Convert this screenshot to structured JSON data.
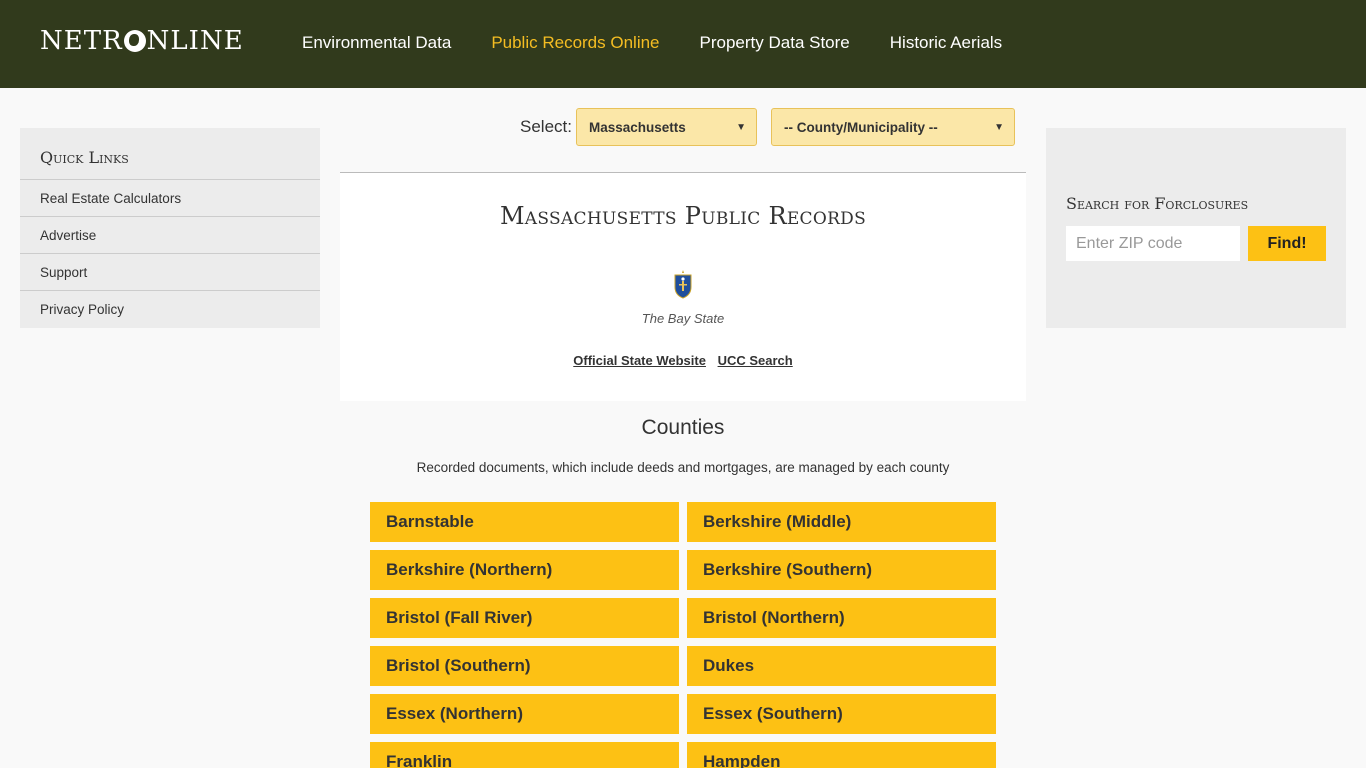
{
  "header": {
    "logo_left": "NETR",
    "logo_right": "NLINE",
    "nav": [
      {
        "label": "Environmental Data"
      },
      {
        "label": "Public Records Online"
      },
      {
        "label": "Property Data Store"
      },
      {
        "label": "Historic Aerials"
      }
    ],
    "active_nav": "Public Records Online"
  },
  "quick_links": {
    "title": "Quick Links",
    "items": [
      {
        "label": "Real Estate Calculators"
      },
      {
        "label": "Advertise"
      },
      {
        "label": "Support"
      },
      {
        "label": "Privacy Policy"
      }
    ]
  },
  "selector": {
    "label": "Select:",
    "state_value": "Massachusetts",
    "county_value": "-- County/Municipality --"
  },
  "state": {
    "title": "Massachusetts Public Records",
    "nickname": "The Bay State",
    "links": [
      {
        "label": "Official State Website"
      },
      {
        "label": "UCC Search"
      }
    ]
  },
  "counties": {
    "title": "Counties",
    "subtitle": "Recorded documents, which include deeds and mortgages, are managed by each county",
    "items": [
      "Barnstable",
      "Berkshire (Middle)",
      "Berkshire (Northern)",
      "Berkshire (Southern)",
      "Bristol (Fall River)",
      "Bristol (Northern)",
      "Bristol (Southern)",
      "Dukes",
      "Essex (Northern)",
      "Essex (Southern)",
      "Franklin",
      "Hampden"
    ]
  },
  "foreclosures": {
    "title": "Search for Forclosures",
    "zip_placeholder": "Enter ZIP code",
    "button": "Find!"
  },
  "colors": {
    "header_bg": "#313a1c",
    "accent": "#fdc114",
    "nav_active": "#f5bd22"
  }
}
